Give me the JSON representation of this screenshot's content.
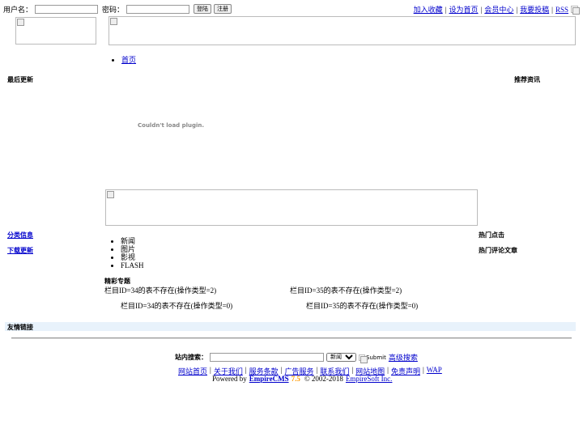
{
  "login": {
    "username_label": "用户名：",
    "password_label": "密码：",
    "login_button": "登陆",
    "register_button": "注册"
  },
  "top_links": [
    "加入收藏",
    "设为首页",
    "会员中心",
    "我要投稿",
    "RSS"
  ],
  "nav": {
    "home": "首页"
  },
  "sections": {
    "latest_update": "最后更新",
    "recommended": "推荐资讯",
    "plugin_message": "Couldn't load plugin.",
    "category_info": "分类信息",
    "download_update": "下载更新",
    "hot_clicks": "热门点击",
    "hot_comments": "热门评论文章",
    "featured_topics": "精彩专题",
    "friend_links": "友情链接"
  },
  "category_list": [
    "新闻",
    "图片",
    "影视",
    "FLASH"
  ],
  "errors": {
    "col34_type2": "栏目ID=34的表不存在(操作类型=2)",
    "col35_type2": "栏目ID=35的表不存在(操作类型=2)",
    "col34_type0": "栏目ID=34的表不存在(操作类型=0)",
    "col35_type0": "栏目ID=35的表不存在(操作类型=0)"
  },
  "search": {
    "label": "站内搜索：",
    "input_value": "",
    "select_value": "新闻",
    "submit": "Submit",
    "advanced": "高级搜索"
  },
  "footer": {
    "links": [
      "网站首页",
      "关于我们",
      "服务条款",
      "广告服务",
      "联系我们",
      "网站地图",
      "免责声明",
      "WAP"
    ],
    "powered_by": "Powered by",
    "empirecms": "EmpireCMS",
    "version": "7.5",
    "copyright": "© 2002-2018",
    "company": "EmpireSoft Inc."
  },
  "colors": {
    "link": "#0000cc",
    "friend_bar": "#e8f2fb",
    "version_orange": "#ff9900"
  }
}
